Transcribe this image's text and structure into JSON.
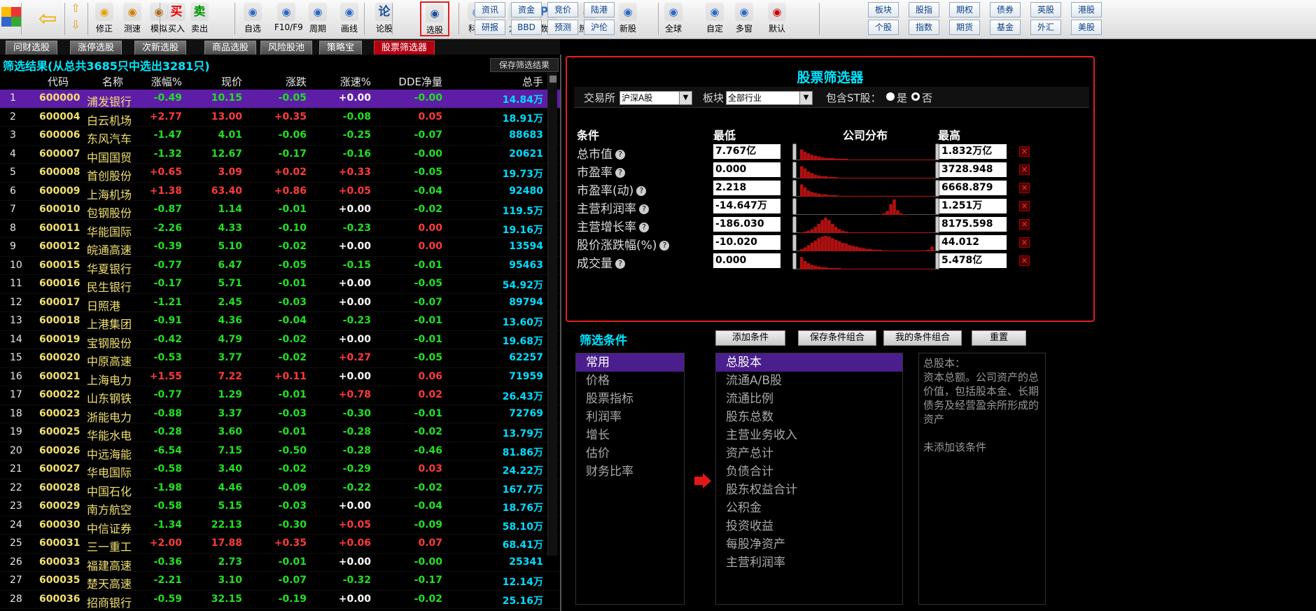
{
  "toolbar": {
    "buttons": [
      {
        "label": "修正",
        "icon": "pencil-icon"
      },
      {
        "label": "测速",
        "icon": "clock-icon"
      },
      {
        "label": "模拟",
        "icon": "hammer-icon"
      },
      {
        "label": "买入",
        "icon": "buy-icon",
        "glyph": "买"
      },
      {
        "label": "卖出",
        "icon": "sell-icon",
        "glyph": "卖"
      },
      {
        "label": "自选",
        "icon": "favorites-icon"
      },
      {
        "label": "F10/F9",
        "icon": "f10-icon"
      },
      {
        "label": "周期",
        "icon": "period-icon"
      },
      {
        "label": "画线",
        "icon": "draw-line-icon"
      },
      {
        "label": "论股",
        "icon": "discuss-icon",
        "glyph": "论"
      },
      {
        "label": "选股",
        "icon": "stock-picker-icon"
      },
      {
        "label": "科创",
        "icon": "sci-tech-icon"
      },
      {
        "label": "龙虎",
        "icon": "dragon-tiger-icon"
      },
      {
        "label": "数据",
        "icon": "data-icon",
        "glyph": "PE"
      },
      {
        "label": "热点",
        "icon": "hotspot-icon"
      },
      {
        "label": "新股",
        "icon": "new-stock-icon"
      },
      {
        "label": "全球",
        "icon": "globe-icon"
      },
      {
        "label": "自定",
        "icon": "custom-icon"
      },
      {
        "label": "多窗",
        "icon": "multi-window-icon"
      },
      {
        "label": "默认",
        "icon": "home-icon"
      }
    ],
    "grid1": [
      [
        "资讯",
        "资金",
        "竞价",
        "陆港"
      ],
      [
        "研报",
        "BBD",
        "预测",
        "沪伦"
      ]
    ],
    "grid2": [
      [
        "板块",
        "股指",
        "期权",
        "债券",
        "英股",
        "港股"
      ],
      [
        "个股",
        "指数",
        "期货",
        "基金",
        "外汇",
        "美股"
      ]
    ]
  },
  "tabs": [
    "问财选股",
    "涨停选股",
    "次新选股",
    "商品选股",
    "风险股池",
    "策略宝",
    "股票筛选器"
  ],
  "left": {
    "title": "筛选结果(从总共3685只中选出3281只)",
    "save_btn": "保存筛选结果",
    "columns": [
      "代码",
      "名称",
      "涨幅%",
      "现价",
      "涨跌",
      "涨速%",
      "DDE净量",
      "总手"
    ],
    "rows": [
      [
        "1",
        "600000",
        "浦发银行",
        "-0.49",
        "10.15",
        "-0.05",
        "+0.00",
        "-0.00",
        "14.84万"
      ],
      [
        "2",
        "600004",
        "白云机场",
        "+2.77",
        "13.00",
        "+0.35",
        "-0.08",
        "0.05",
        "18.91万"
      ],
      [
        "3",
        "600006",
        "东风汽车",
        "-1.47",
        "4.01",
        "-0.06",
        "-0.25",
        "-0.07",
        "88683"
      ],
      [
        "4",
        "600007",
        "中国国贸",
        "-1.32",
        "12.67",
        "-0.17",
        "-0.16",
        "-0.00",
        "20621"
      ],
      [
        "5",
        "600008",
        "首创股份",
        "+0.65",
        "3.09",
        "+0.02",
        "+0.33",
        "-0.05",
        "19.73万"
      ],
      [
        "6",
        "600009",
        "上海机场",
        "+1.38",
        "63.40",
        "+0.86",
        "+0.05",
        "-0.04",
        "92480"
      ],
      [
        "7",
        "600010",
        "包钢股份",
        "-0.87",
        "1.14",
        "-0.01",
        "+0.00",
        "-0.02",
        "119.5万"
      ],
      [
        "8",
        "600011",
        "华能国际",
        "-2.26",
        "4.33",
        "-0.10",
        "-0.23",
        "0.00",
        "19.16万"
      ],
      [
        "9",
        "600012",
        "皖通高速",
        "-0.39",
        "5.10",
        "-0.02",
        "+0.00",
        "0.00",
        "13594"
      ],
      [
        "10",
        "600015",
        "华夏银行",
        "-0.77",
        "6.47",
        "-0.05",
        "-0.15",
        "-0.01",
        "95463"
      ],
      [
        "11",
        "600016",
        "民生银行",
        "-0.17",
        "5.71",
        "-0.01",
        "+0.00",
        "-0.05",
        "54.92万"
      ],
      [
        "12",
        "600017",
        "日照港",
        "-1.21",
        "2.45",
        "-0.03",
        "+0.00",
        "-0.07",
        "89794"
      ],
      [
        "13",
        "600018",
        "上港集团",
        "-0.91",
        "4.36",
        "-0.04",
        "-0.23",
        "-0.01",
        "13.60万"
      ],
      [
        "14",
        "600019",
        "宝钢股份",
        "-0.42",
        "4.79",
        "-0.02",
        "+0.00",
        "-0.01",
        "19.68万"
      ],
      [
        "15",
        "600020",
        "中原高速",
        "-0.53",
        "3.77",
        "-0.02",
        "+0.27",
        "-0.05",
        "62257"
      ],
      [
        "16",
        "600021",
        "上海电力",
        "+1.55",
        "7.22",
        "+0.11",
        "+0.00",
        "0.06",
        "71959"
      ],
      [
        "17",
        "600022",
        "山东钢铁",
        "-0.77",
        "1.29",
        "-0.01",
        "+0.78",
        "0.02",
        "26.43万"
      ],
      [
        "18",
        "600023",
        "浙能电力",
        "-0.88",
        "3.37",
        "-0.03",
        "-0.30",
        "-0.01",
        "72769"
      ],
      [
        "19",
        "600025",
        "华能水电",
        "-0.28",
        "3.60",
        "-0.01",
        "-0.28",
        "-0.02",
        "13.79万"
      ],
      [
        "20",
        "600026",
        "中远海能",
        "-6.54",
        "7.15",
        "-0.50",
        "-0.28",
        "-0.46",
        "81.86万"
      ],
      [
        "21",
        "600027",
        "华电国际",
        "-0.58",
        "3.40",
        "-0.02",
        "-0.29",
        "0.03",
        "24.22万"
      ],
      [
        "22",
        "600028",
        "中国石化",
        "-1.98",
        "4.46",
        "-0.09",
        "-0.22",
        "-0.02",
        "167.7万"
      ],
      [
        "23",
        "600029",
        "南方航空",
        "-0.58",
        "5.15",
        "-0.03",
        "+0.00",
        "-0.04",
        "18.76万"
      ],
      [
        "24",
        "600030",
        "中信证券",
        "-1.34",
        "22.13",
        "-0.30",
        "+0.05",
        "-0.09",
        "58.10万"
      ],
      [
        "25",
        "600031",
        "三一重工",
        "+2.00",
        "17.88",
        "+0.35",
        "+0.06",
        "0.07",
        "68.41万"
      ],
      [
        "26",
        "600033",
        "福建高速",
        "-0.36",
        "2.73",
        "-0.01",
        "+0.00",
        "-0.00",
        "25341"
      ],
      [
        "27",
        "600035",
        "楚天高速",
        "-2.21",
        "3.10",
        "-0.07",
        "-0.32",
        "-0.17",
        "12.14万"
      ],
      [
        "28",
        "600036",
        "招商银行",
        "-0.59",
        "32.15",
        "-0.19",
        "+0.00",
        "-0.02",
        "25.16万"
      ]
    ]
  },
  "screener": {
    "title": "股票筛选器",
    "exchange_label": "交易所",
    "exchange_value": "沪深A股",
    "sector_label": "板块",
    "sector_value": "全部行业",
    "st_label": "包含ST股：",
    "st_yes": "是",
    "st_no": "否",
    "header": {
      "cond": "条件",
      "low": "最低",
      "dist": "公司分布",
      "high": "最高"
    },
    "conditions": [
      {
        "name": "总市值",
        "low": "7.767亿",
        "high": "1.832万亿",
        "dist": [
          0,
          14,
          11,
          9,
          7,
          6,
          5,
          4,
          3,
          3,
          3,
          2,
          2,
          2,
          2,
          1,
          1,
          1,
          1,
          1,
          1,
          1,
          1,
          1,
          1,
          1,
          1,
          1,
          1,
          1,
          1,
          1,
          1,
          1,
          1,
          1,
          1,
          1,
          1,
          1
        ]
      },
      {
        "name": "市盈率",
        "low": "0.000",
        "high": "3728.948",
        "dist": [
          0,
          16,
          13,
          9,
          7,
          5,
          4,
          3,
          3,
          2,
          2,
          2,
          1,
          1,
          1,
          1,
          1,
          1,
          1,
          1,
          1,
          1,
          1,
          1,
          1,
          1,
          1,
          1,
          1,
          1,
          1,
          1,
          1,
          1,
          1,
          1,
          1,
          1,
          1,
          1
        ]
      },
      {
        "name": "市盈率(动)",
        "low": "2.218",
        "high": "6668.879",
        "dist": [
          0,
          16,
          12,
          8,
          6,
          5,
          4,
          3,
          3,
          2,
          2,
          2,
          1,
          1,
          1,
          1,
          1,
          1,
          1,
          1,
          1,
          1,
          1,
          1,
          1,
          1,
          1,
          1,
          1,
          1,
          1,
          1,
          1,
          1,
          1,
          1,
          1,
          1,
          1,
          1
        ]
      },
      {
        "name": "主营利润率",
        "low": "-14.647万",
        "high": "1.251万",
        "dist": [
          0,
          0,
          0,
          0,
          0,
          0,
          0,
          0,
          0,
          0,
          0,
          0,
          0,
          0,
          0,
          0,
          0,
          0,
          0,
          0,
          0,
          0,
          0,
          0,
          1,
          2,
          5,
          14,
          20,
          6,
          2,
          1,
          0,
          0,
          0,
          0,
          0,
          0,
          0,
          0
        ]
      },
      {
        "name": "主营增长率",
        "low": "-186.030",
        "high": "8175.598",
        "dist": [
          0,
          1,
          2,
          3,
          5,
          8,
          12,
          17,
          20,
          17,
          12,
          8,
          5,
          3,
          2,
          1,
          1,
          1,
          1,
          1,
          1,
          1,
          1,
          1,
          1,
          1,
          1,
          1,
          1,
          1,
          1,
          1,
          1,
          1,
          1,
          1,
          1,
          1,
          1,
          1
        ]
      },
      {
        "name": "股价涨跌幅(%)",
        "low": "-10.020",
        "high": "44.012",
        "dist": [
          0,
          3,
          5,
          8,
          11,
          14,
          17,
          19,
          20,
          19,
          17,
          15,
          13,
          11,
          10,
          8,
          7,
          6,
          5,
          4,
          3,
          3,
          2,
          2,
          2,
          1,
          1,
          1,
          1,
          1,
          1,
          1,
          1,
          1,
          1,
          1,
          1,
          1,
          2,
          6
        ]
      },
      {
        "name": "成交量",
        "low": "0.000",
        "high": "5.478亿",
        "dist": [
          0,
          16,
          11,
          8,
          6,
          5,
          4,
          3,
          3,
          2,
          2,
          2,
          2,
          1,
          1,
          1,
          1,
          1,
          1,
          1,
          1,
          1,
          1,
          1,
          1,
          1,
          1,
          1,
          1,
          1,
          1,
          1,
          1,
          1,
          1,
          1,
          1,
          1,
          1,
          1
        ]
      }
    ],
    "delete_glyph": "×"
  },
  "bottom": {
    "label": "筛选条件",
    "buttons": [
      "添加条件",
      "保存条件组合",
      "我的条件组合",
      "重置"
    ],
    "categories": [
      "常用",
      "价格",
      "股票指标",
      "利润率",
      "增长",
      "估价",
      "财务比率"
    ],
    "fields": [
      "总股本",
      "流通A/B股",
      "流通比例",
      "股东总数",
      "主营业务收入",
      "资产总计",
      "负债合计",
      "股东权益合计",
      "公积金",
      "投资收益",
      "每股净资产",
      "主营利润率"
    ],
    "desc_title": "总股本：",
    "desc_body": "资本总额。公司资产的总价值，包括股本金、长期债务及经营盈余所形成的资产",
    "desc_note": "未添加该条件"
  },
  "colors": {
    "up": "#ff3b3b",
    "down": "#22e022",
    "flat": "#ffffff",
    "accent": "#00e5ff",
    "selected": "#5e1da6",
    "border": "#e02020"
  }
}
